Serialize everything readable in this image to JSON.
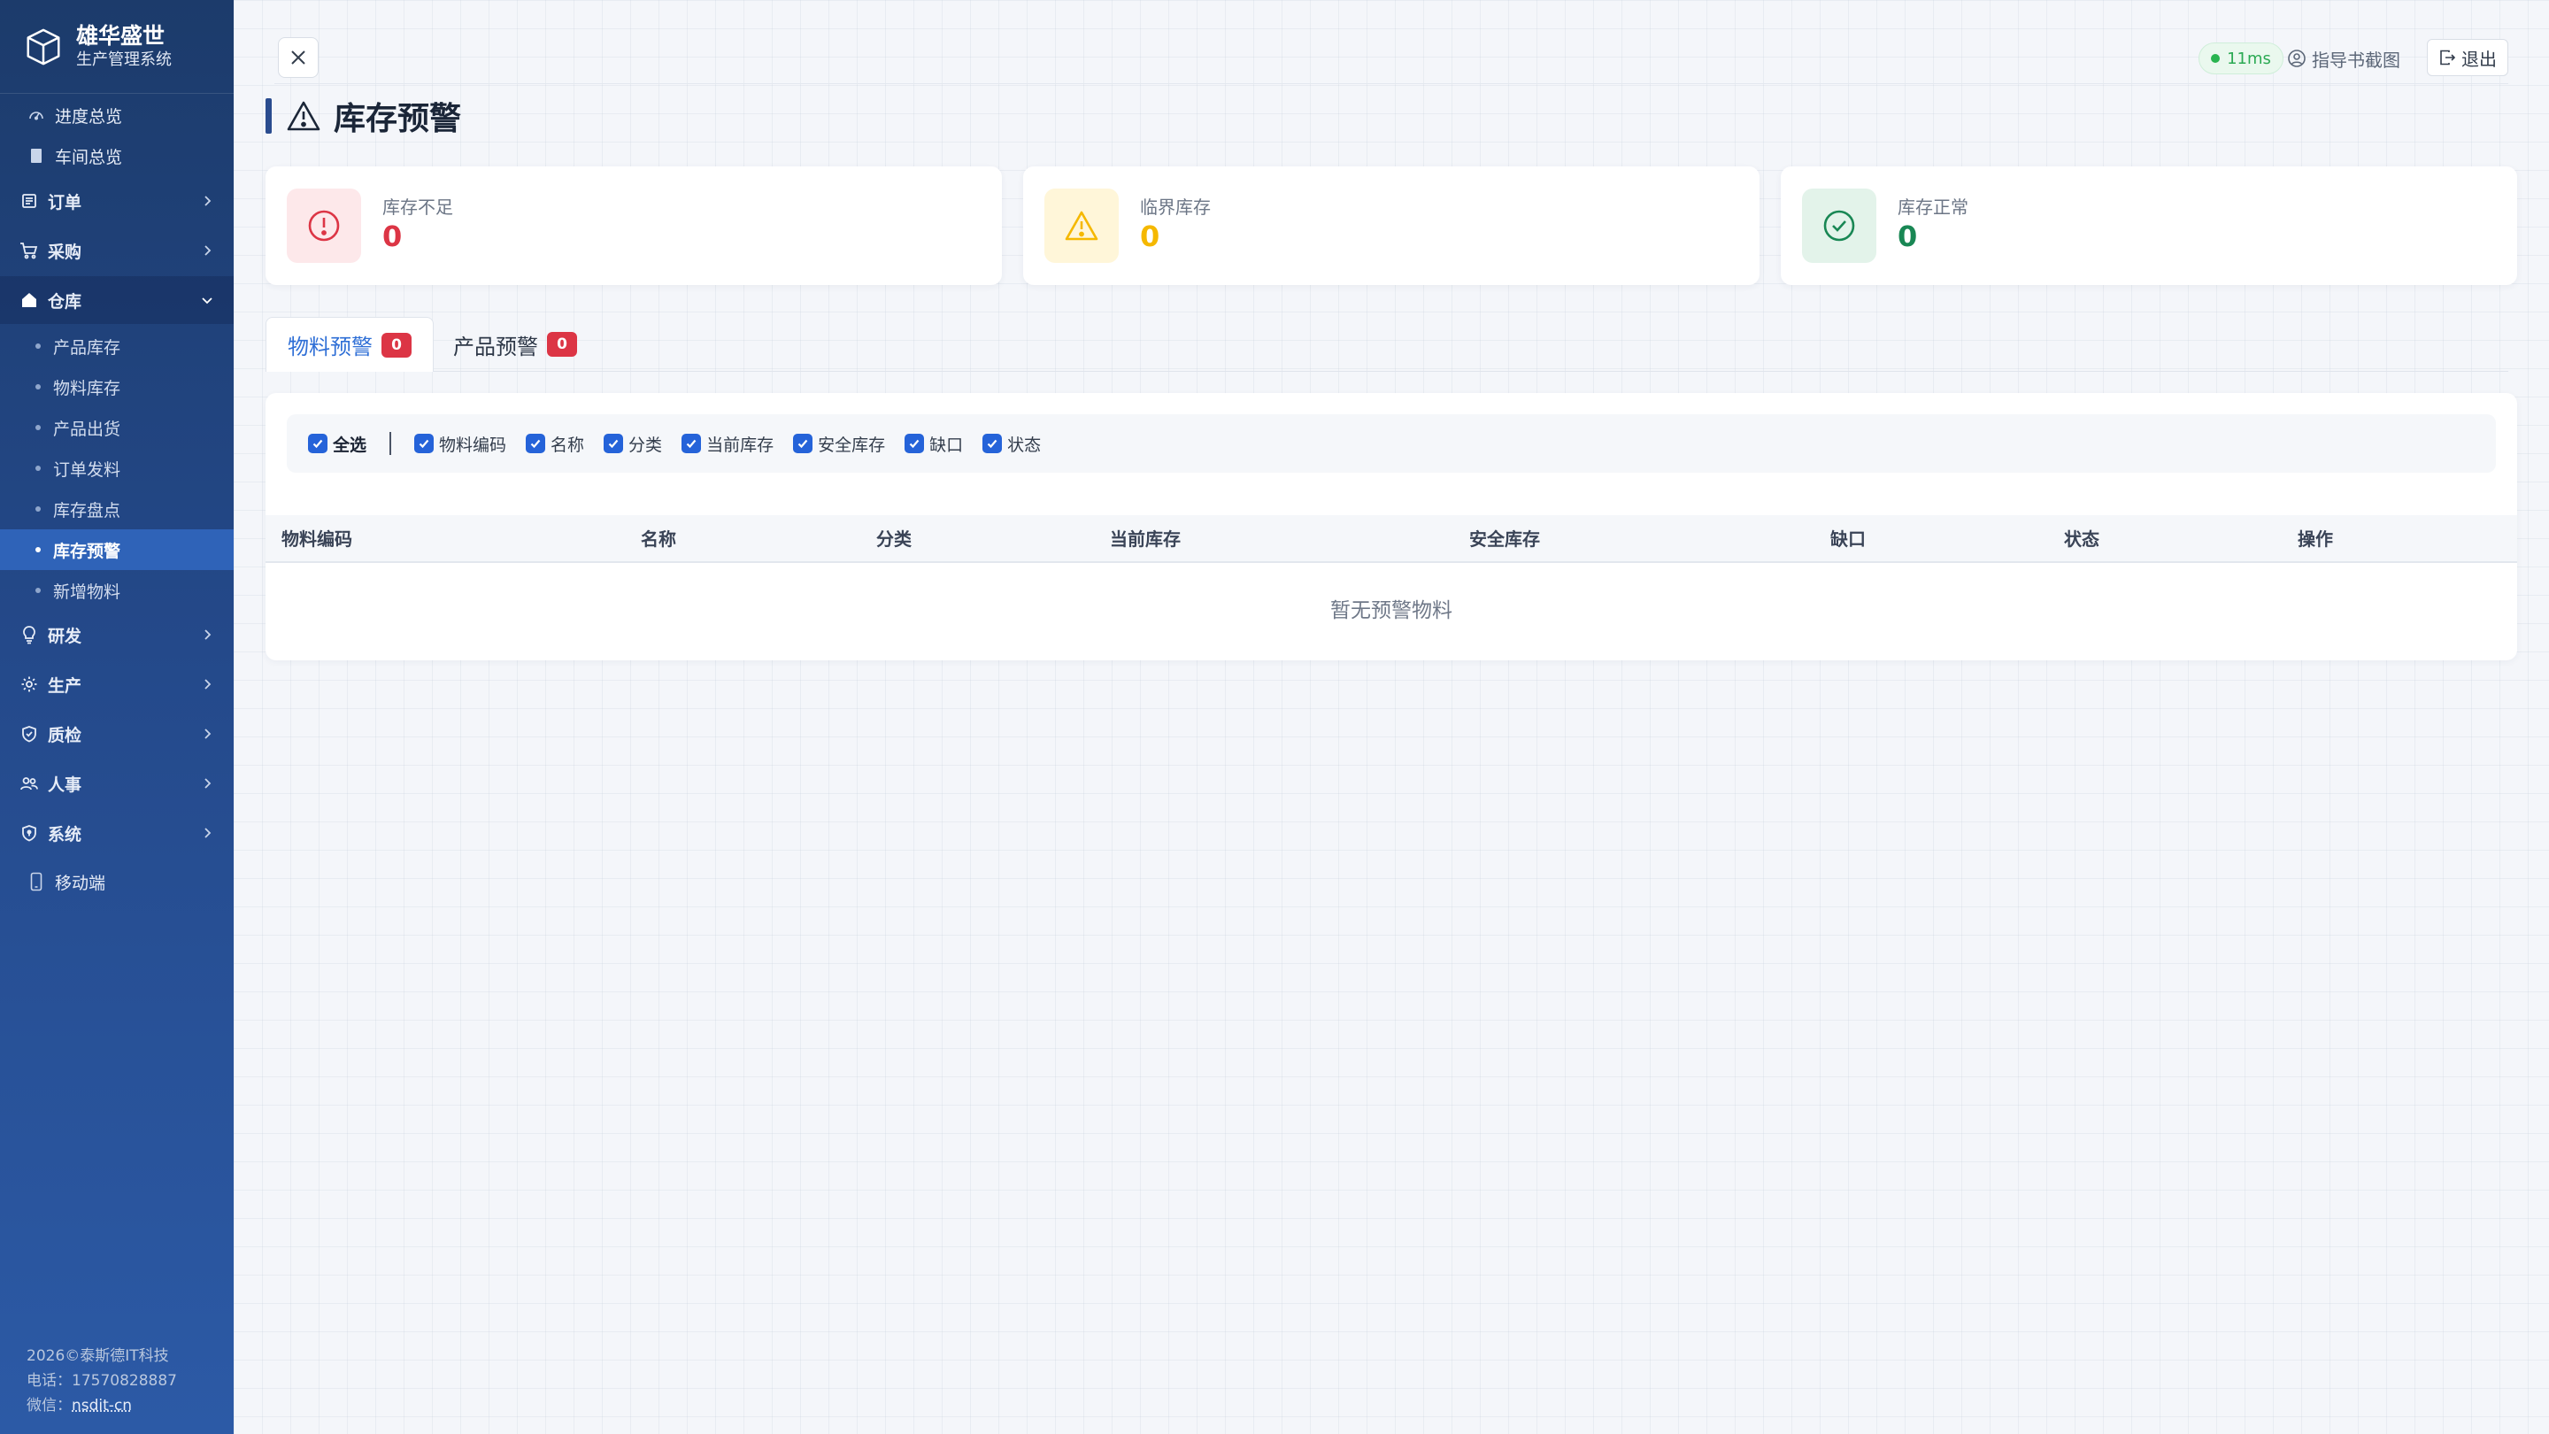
{
  "brand": {
    "name": "雄华盛世",
    "subtitle": "生产管理系统"
  },
  "sidebar": {
    "items": [
      {
        "label": "进度总览",
        "icon": "gauge-icon",
        "kind": "simple"
      },
      {
        "label": "车间总览",
        "icon": "building-icon",
        "kind": "simple"
      },
      {
        "label": "订单",
        "icon": "receipt-icon",
        "kind": "top"
      },
      {
        "label": "采购",
        "icon": "cart-icon",
        "kind": "top"
      },
      {
        "label": "仓库",
        "icon": "house-icon",
        "kind": "top",
        "open": true
      },
      {
        "label": "研发",
        "icon": "lightbulb-icon",
        "kind": "top"
      },
      {
        "label": "生产",
        "icon": "gear-icon",
        "kind": "top"
      },
      {
        "label": "质检",
        "icon": "shield-check-icon",
        "kind": "top"
      },
      {
        "label": "人事",
        "icon": "people-icon",
        "kind": "top"
      },
      {
        "label": "系统",
        "icon": "shield-lock-icon",
        "kind": "top"
      },
      {
        "label": "移动端",
        "icon": "phone-icon",
        "kind": "simple"
      }
    ],
    "warehouse_sub": [
      "产品库存",
      "物料库存",
      "产品出货",
      "订单发料",
      "库存盘点",
      "库存预警",
      "新增物料"
    ],
    "active_sub": "库存预警"
  },
  "footer": {
    "copyright": "2026©泰斯德IT科技",
    "phone": "电话：17570828887",
    "wechat_label": "微信：",
    "wechat": "nsdit-cn"
  },
  "topbar": {
    "latency": "11ms",
    "guide": "指导书截图",
    "logout": "退出"
  },
  "page": {
    "title": "库存预警"
  },
  "stats": [
    {
      "label": "库存不足",
      "value": "0",
      "color": "#dc3545",
      "bg": "#fde8ea",
      "icon": "alert-circle-icon"
    },
    {
      "label": "临界库存",
      "value": "0",
      "color": "#f5b800",
      "bg": "#fff6d9",
      "icon": "warning-triangle-icon"
    },
    {
      "label": "库存正常",
      "value": "0",
      "color": "#198754",
      "bg": "#e3f3ea",
      "icon": "check-circle-icon"
    }
  ],
  "tabs": [
    {
      "label": "物料预警",
      "count": "0",
      "active": true
    },
    {
      "label": "产品预警",
      "count": "0",
      "active": false
    }
  ],
  "filters": {
    "select_all": "全选",
    "columns": [
      "物料编码",
      "名称",
      "分类",
      "当前库存",
      "安全库存",
      "缺口",
      "状态"
    ]
  },
  "table": {
    "headers": [
      "物料编码",
      "名称",
      "分类",
      "当前库存",
      "安全库存",
      "缺口",
      "状态",
      "操作"
    ],
    "empty_text": "暂无预警物料"
  }
}
